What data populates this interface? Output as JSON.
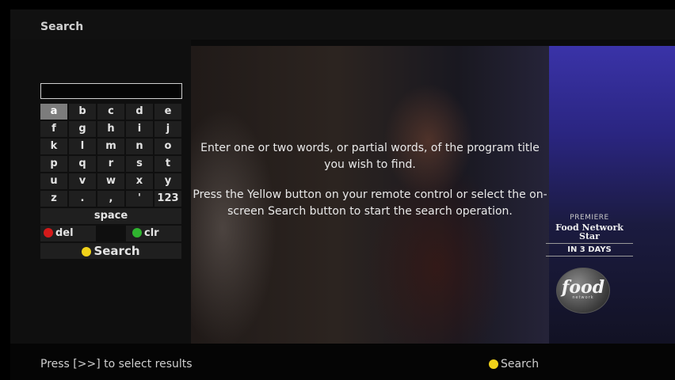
{
  "header": {
    "title": "Search"
  },
  "search_field": {
    "value": ""
  },
  "keypad": {
    "rows": [
      [
        "a",
        "b",
        "c",
        "d",
        "e"
      ],
      [
        "f",
        "g",
        "h",
        "i",
        "j"
      ],
      [
        "k",
        "l",
        "m",
        "n",
        "o"
      ],
      [
        "p",
        "q",
        "r",
        "s",
        "t"
      ],
      [
        "u",
        "v",
        "w",
        "x",
        "y"
      ],
      [
        "z",
        ".",
        ",",
        "'",
        "123"
      ]
    ],
    "selected": "a",
    "space_label": "space",
    "del_label": "del",
    "clr_label": "clr",
    "search_label": "Search"
  },
  "instructions": {
    "line1": "Enter one or two words, or partial words, of the program title you wish to find.",
    "line2": "Press the Yellow button on your remote control or select the on-screen Search button to start the search operation."
  },
  "promo": {
    "label": "PREMIERE",
    "title": "Food Network Star",
    "when": "IN 3 DAYS",
    "logo_text": "food",
    "logo_sub": "network"
  },
  "footer": {
    "hint": "Press [>>] to select results",
    "search_label": "Search"
  },
  "colors": {
    "red": "#d41a1a",
    "green": "#2fb52f",
    "yellow": "#f1d21a"
  }
}
